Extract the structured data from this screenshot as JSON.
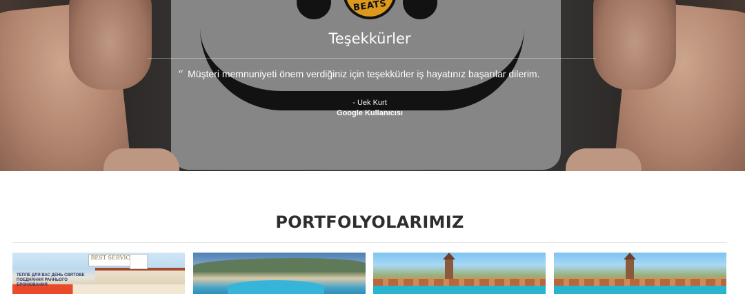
{
  "testimonial": {
    "title": "Teşekkürler",
    "quote_mark": "“",
    "text": "Müşteri memnuniyeti önem verdiğiniz için teşekkürler iş hayatınız başarılar dilerim.",
    "author": "- Uek Kurt",
    "source": "Google Kullanıcısı",
    "background_logo_text": "BEATS"
  },
  "portfolio": {
    "title": "PORTFOLYOLARIMIZ",
    "items": [
      {
        "label": "portfolio-hotel-1",
        "banner_tag": "BEST SERVICE",
        "banner_text": "ТЕПЛЕ ДЛЯ ВАС ДЕНЬ СВЯТОВЕ ПОЕДНАННЯ РАННЬОГО БРОНЮВАННЯ"
      },
      {
        "label": "portfolio-hotel-2"
      },
      {
        "label": "portfolio-hotel-3"
      },
      {
        "label": "portfolio-hotel-4"
      }
    ]
  },
  "colors": {
    "section_title": "#2e2e2e",
    "testimonial_text": "#ffffff",
    "divider": "#e4e4e4"
  }
}
